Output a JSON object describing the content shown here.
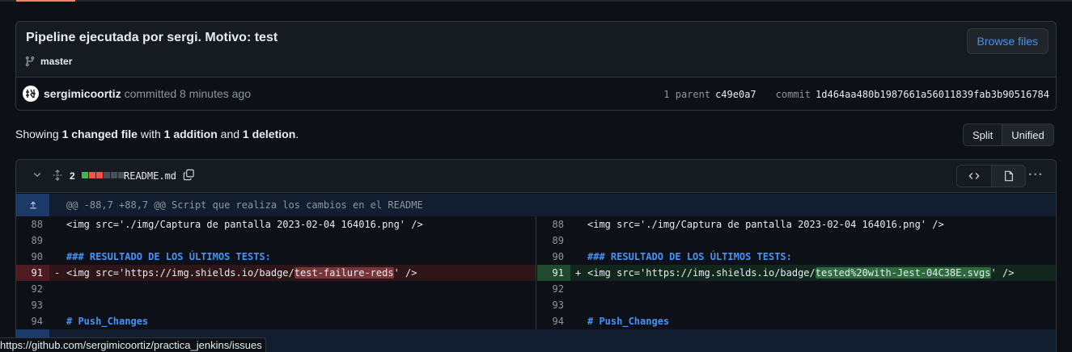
{
  "commit": {
    "title": "Pipeline ejecutada por sergi. Motivo: test",
    "branch": "master",
    "browse_label": "Browse files",
    "author": "sergimicoortiz",
    "action": "committed 8 minutes ago",
    "parent_label": "1 parent",
    "parent_sha": "c49e0a7",
    "commit_label": "commit",
    "commit_sha": "1d464aa480b1987661a56011839fab3b90516784"
  },
  "summary": {
    "prefix": "Showing ",
    "changed": "1 changed file",
    "with": " with ",
    "additions": "1 addition",
    "and": " and ",
    "deletions": "1 deletion",
    "suffix": "."
  },
  "view_toggle": {
    "split": "Split",
    "unified": "Unified"
  },
  "file": {
    "changes": "2",
    "name": "README.md",
    "diffstat_colors": [
      "#3fb950",
      "#f85149",
      "#f85149",
      "#484f58",
      "#484f58",
      "#484f58"
    ],
    "hunk": "@@ -88,7 +88,7 @@ Script que realiza los cambios en el README"
  },
  "diff_left": [
    {
      "ln": "88",
      "code": "<img src='./img/Captura de pantalla 2023-02-04 164016.png' />"
    },
    {
      "ln": "89",
      "code": ""
    },
    {
      "ln": "90",
      "code": "### RESULTADO DE LOS ÚLTIMOS TESTS:"
    },
    {
      "ln": "91",
      "pre": "<img src='https://img.shields.io/badge/",
      "hl": "test-failure-reds",
      "post": "' />"
    },
    {
      "ln": "92",
      "code": ""
    },
    {
      "ln": "93",
      "code": ""
    },
    {
      "ln": "94",
      "code": "# Push_Changes"
    }
  ],
  "diff_right": [
    {
      "ln": "88",
      "code": "<img src='./img/Captura de pantalla 2023-02-04 164016.png' />"
    },
    {
      "ln": "89",
      "code": ""
    },
    {
      "ln": "90",
      "code": "### RESULTADO DE LOS ÚLTIMOS TESTS:"
    },
    {
      "ln": "91",
      "pre": "<img src='https://img.shields.io/badge/",
      "hl": "tested%20with-Jest-04C38E.svgs",
      "post": "' />"
    },
    {
      "ln": "92",
      "code": ""
    },
    {
      "ln": "93",
      "code": ""
    },
    {
      "ln": "94",
      "code": "# Push_Changes"
    }
  ],
  "markers": {
    "del": "-",
    "add": "+"
  },
  "status_url": "https://github.com/sergimicoortiz/practica_jenkins/issues"
}
